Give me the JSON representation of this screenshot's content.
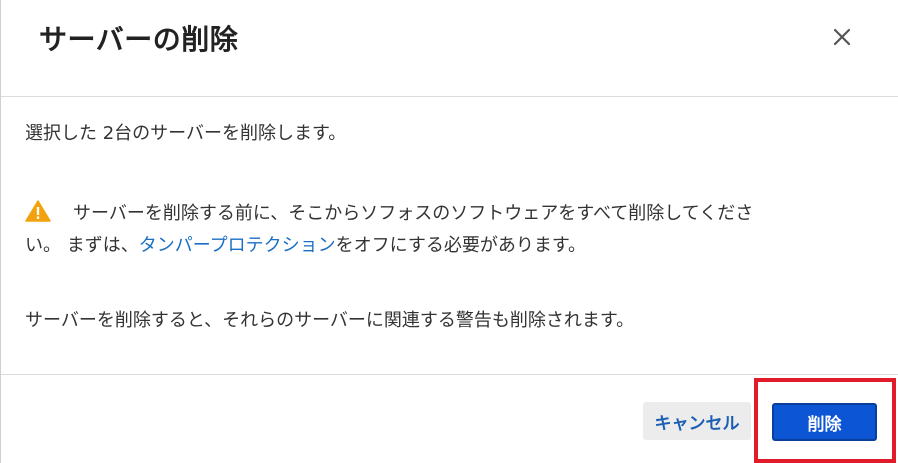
{
  "dialog": {
    "title": "サーバーの削除",
    "close_icon": "close-icon"
  },
  "body": {
    "selection_text": "選択した 2台のサーバーを削除します。",
    "warning": {
      "icon": "warning-icon",
      "icon_color": "#f2a20c",
      "text_before_line": "サーバーを削除する前に、そこからソフォスのソフトウェアをすべて削除してくださ",
      "text_line2_start": "い。 まずは、",
      "link_text": "タンパープロテクション",
      "text_after_link": "をオフにする必要があります。"
    },
    "alert_note": "サーバーを削除すると、それらのサーバーに関連する警告も削除されます。"
  },
  "footer": {
    "cancel_label": "キャンセル",
    "delete_label": "削除"
  },
  "colors": {
    "link": "#1a6fc4",
    "primary_button": "#0c55d4",
    "highlight_box": "#e21b2b"
  }
}
